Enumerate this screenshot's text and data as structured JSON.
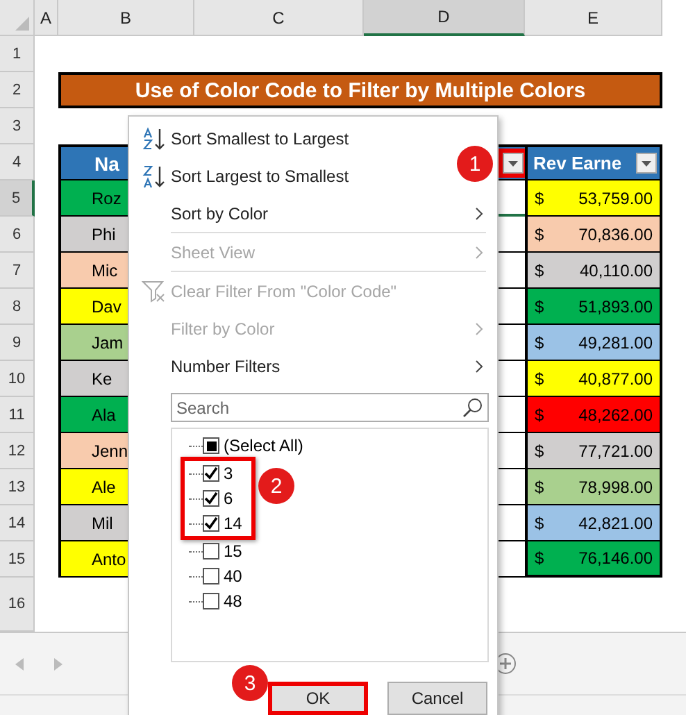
{
  "columns": [
    "A",
    "B",
    "C",
    "D",
    "E"
  ],
  "row_numbers": [
    "1",
    "2",
    "3",
    "4",
    "5",
    "6",
    "7",
    "8",
    "9",
    "10",
    "11",
    "12",
    "13",
    "14",
    "15",
    "16"
  ],
  "title": "Use of Color Code to Filter by Multiple Colors",
  "header": {
    "name": "Na",
    "revenue": "Rev Earne"
  },
  "rows": [
    {
      "name": {
        "text": "Roz",
        "color": "#00b050"
      },
      "amount": {
        "currency": "$",
        "value": "53,759.00",
        "color": "#ffff00"
      }
    },
    {
      "name": {
        "text": "Phi",
        "color": "#d0cece"
      },
      "amount": {
        "currency": "$",
        "value": "70,836.00",
        "color": "#f8cbad"
      }
    },
    {
      "name": {
        "text": "Mic",
        "color": "#f8cbad"
      },
      "amount": {
        "currency": "$",
        "value": "40,110.00",
        "color": "#d0cece"
      }
    },
    {
      "name": {
        "text": "Dav",
        "color": "#ffff00"
      },
      "amount": {
        "currency": "$",
        "value": "51,893.00",
        "color": "#00b050"
      }
    },
    {
      "name": {
        "text": "Jam",
        "color": "#a9d08e"
      },
      "amount": {
        "currency": "$",
        "value": "49,281.00",
        "color": "#9bc2e6"
      }
    },
    {
      "name": {
        "text": "Ke",
        "color": "#d0cece"
      },
      "amount": {
        "currency": "$",
        "value": "40,877.00",
        "color": "#ffff00"
      }
    },
    {
      "name": {
        "text": "Ala",
        "color": "#00b050"
      },
      "amount": {
        "currency": "$",
        "value": "48,262.00",
        "color": "#ff0000"
      }
    },
    {
      "name": {
        "text": "Jenn",
        "color": "#f8cbad"
      },
      "amount": {
        "currency": "$",
        "value": "77,721.00",
        "color": "#d0cece"
      }
    },
    {
      "name": {
        "text": "Ale",
        "color": "#ffff00"
      },
      "amount": {
        "currency": "$",
        "value": "78,998.00",
        "color": "#a9d08e"
      }
    },
    {
      "name": {
        "text": "Mil",
        "color": "#d0cece"
      },
      "amount": {
        "currency": "$",
        "value": "42,821.00",
        "color": "#9bc2e6"
      }
    },
    {
      "name": {
        "text": "Anto",
        "color": "#ffff00"
      },
      "amount": {
        "currency": "$",
        "value": "76,146.00",
        "color": "#00b050"
      }
    }
  ],
  "menu": {
    "items": [
      {
        "kind": "sort-asc",
        "label": "Sort Smallest to Largest",
        "disabled": false
      },
      {
        "kind": "sort-desc",
        "label": "Sort Largest to Smallest",
        "disabled": false
      },
      {
        "kind": "submenu",
        "label": "Sort by Color",
        "disabled": false
      },
      {
        "kind": "submenu",
        "label": "Sheet View",
        "disabled": true
      },
      {
        "kind": "clear",
        "label": "Clear Filter From \"Color Code\"",
        "disabled": true
      },
      {
        "kind": "submenu",
        "label": "Filter by Color",
        "disabled": true
      },
      {
        "kind": "submenu",
        "label": "Number Filters",
        "disabled": false
      }
    ],
    "search": {
      "placeholder": "Search"
    },
    "values": [
      {
        "label": "(Select All)",
        "checked": false,
        "indeterminate": true,
        "highlighted": false
      },
      {
        "label": "3",
        "checked": true,
        "highlighted": true
      },
      {
        "label": "6",
        "checked": true,
        "highlighted": true
      },
      {
        "label": "14",
        "checked": true,
        "highlighted": true
      },
      {
        "label": "15",
        "checked": false,
        "highlighted": false
      },
      {
        "label": "40",
        "checked": false,
        "highlighted": false
      },
      {
        "label": "48",
        "checked": false,
        "highlighted": false
      }
    ],
    "buttons": [
      {
        "label": "OK",
        "highlighted": true
      },
      {
        "label": "Cancel",
        "highlighted": false
      }
    ]
  },
  "steps": [
    "1",
    "2",
    "3"
  ]
}
